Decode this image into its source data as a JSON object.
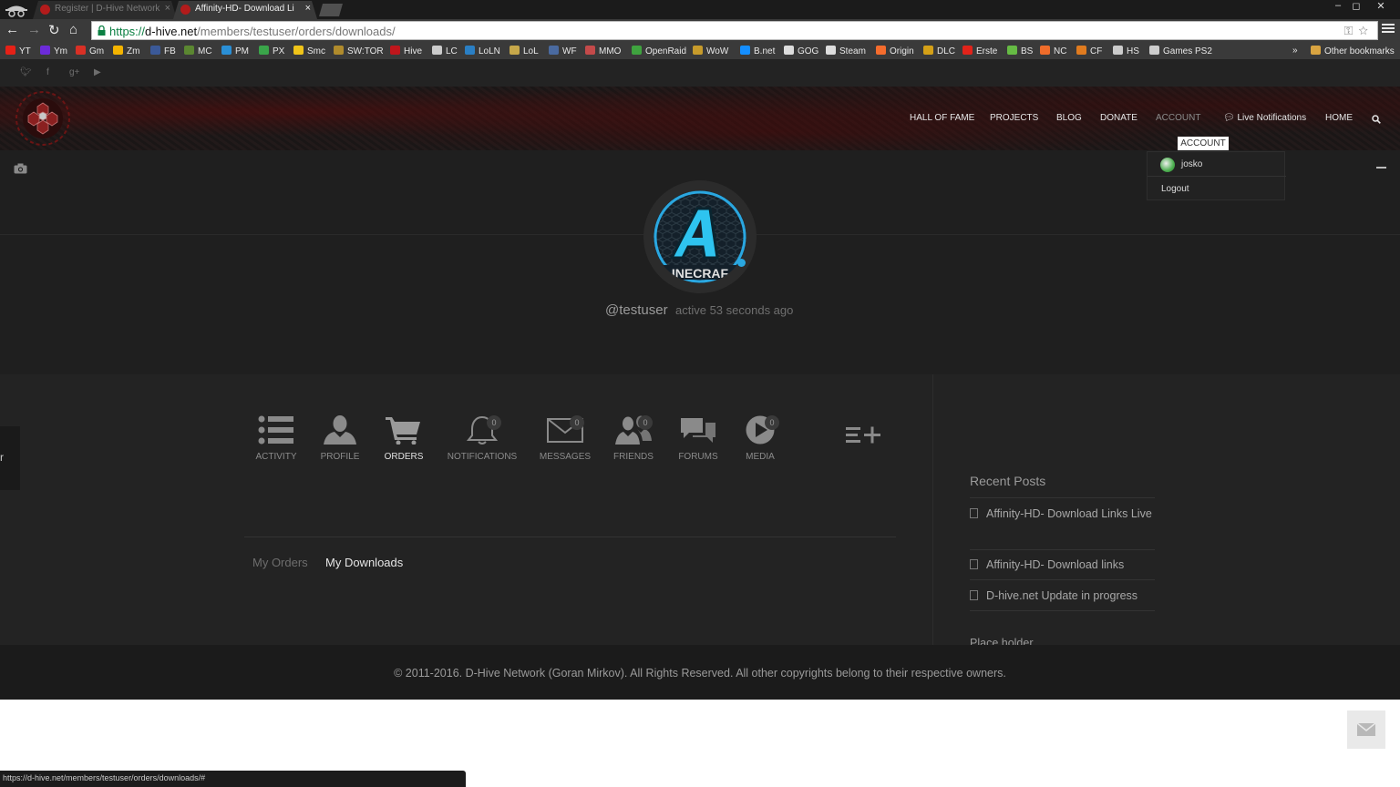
{
  "browser": {
    "tabs": [
      {
        "title": "Register | D-Hive Network",
        "close": "×"
      },
      {
        "title": "Affinity-HD- Download Li",
        "close": "×"
      }
    ],
    "window_controls": [
      "–",
      "◻",
      "✕"
    ],
    "url": {
      "scheme": "https://",
      "host": "d-hive.net",
      "path": "/members/testuser/orders/downloads/"
    },
    "bookmarks": [
      {
        "label": "YT",
        "color": "#e62117"
      },
      {
        "label": "Ym",
        "color": "#6c2bd9"
      },
      {
        "label": "Gm",
        "color": "#d93025"
      },
      {
        "label": "Zm",
        "color": "#f4b400"
      },
      {
        "label": "FB",
        "color": "#3b5998"
      },
      {
        "label": "MC",
        "color": "#5b8731"
      },
      {
        "label": "PM",
        "color": "#2a8fd6"
      },
      {
        "label": "PX",
        "color": "#3aa54a"
      },
      {
        "label": "Smc",
        "color": "#f0c419"
      },
      {
        "label": "SW:TOR",
        "color": "#b08b2c"
      },
      {
        "label": "Hive",
        "color": "#c0161c"
      },
      {
        "label": "LC",
        "color": "#cccccc"
      },
      {
        "label": "LoLN",
        "color": "#2a7fc4"
      },
      {
        "label": "LoL",
        "color": "#c7a84a"
      },
      {
        "label": "WF",
        "color": "#4a6aa0"
      },
      {
        "label": "MMO",
        "color": "#c44a4a"
      },
      {
        "label": "OpenRaid",
        "color": "#3fa33f"
      },
      {
        "label": "WoW",
        "color": "#c79b2b"
      },
      {
        "label": "B.net",
        "color": "#148eff"
      },
      {
        "label": "GOG",
        "color": "#dddddd"
      },
      {
        "label": "Steam",
        "color": "#dddddd"
      },
      {
        "label": "Origin",
        "color": "#f56c2d"
      },
      {
        "label": "DLC",
        "color": "#d4a017"
      },
      {
        "label": "Erste",
        "color": "#e2231a"
      },
      {
        "label": "BS",
        "color": "#66bb44"
      },
      {
        "label": "NC",
        "color": "#ef6c2a"
      },
      {
        "label": "CF",
        "color": "#e07b1f"
      },
      {
        "label": "HS",
        "color": "#cccccc"
      },
      {
        "label": "Games PS2",
        "color": "#cccccc"
      }
    ],
    "overflow": "»",
    "other_bookmarks": "Other bookmarks",
    "status_url": "https://d-hive.net/members/testuser/orders/downloads/#"
  },
  "site": {
    "nav": [
      {
        "label": "HALL OF FAME",
        "dim": false
      },
      {
        "label": "PROJECTS",
        "dim": false
      },
      {
        "label": "BLOG",
        "dim": false
      },
      {
        "label": "DONATE",
        "dim": false
      },
      {
        "label": "ACCOUNT",
        "dim": true
      },
      {
        "label": "Live Notifications",
        "dim": false
      },
      {
        "label": "HOME",
        "dim": false
      }
    ],
    "account_tooltip": "ACCOUNT",
    "dropdown": {
      "user": "josko",
      "logout": "Logout"
    },
    "profile": {
      "handle": "@testuser",
      "activity": "active 53 seconds ago",
      "side_tab_text": "r"
    },
    "tabs": [
      {
        "label": "ACTIVITY",
        "icon": "list-icon",
        "badge": null
      },
      {
        "label": "PROFILE",
        "icon": "user-icon",
        "badge": null
      },
      {
        "label": "ORDERS",
        "icon": "cart-icon",
        "badge": null,
        "active": true
      },
      {
        "label": "NOTIFICATIONS",
        "icon": "bell-icon",
        "badge": "0"
      },
      {
        "label": "MESSAGES",
        "icon": "envelope-icon",
        "badge": "0"
      },
      {
        "label": "FRIENDS",
        "icon": "friends-icon",
        "badge": "0"
      },
      {
        "label": "FORUMS",
        "icon": "forums-icon",
        "badge": null
      },
      {
        "label": "MEDIA",
        "icon": "play-icon",
        "badge": "0"
      }
    ],
    "subnav": {
      "my_orders": "My Orders",
      "my_downloads": "My Downloads"
    },
    "recent_posts": {
      "title": "Recent Posts",
      "items": [
        "Affinity-HD- Download Links Live",
        "Affinity-HD- Download links",
        "D-hive.net Update in progress"
      ]
    },
    "placeholder": "Place holder",
    "footer": "© 2011-2016. D-Hive Network (Goran Mirkov). All Rights Reserved. All other copyrights belong to their respective owners.",
    "colors": {
      "accent_blue": "#2aa7e0",
      "header_red": "#5a0a0a",
      "page_bg": "#1f1f1f"
    }
  }
}
